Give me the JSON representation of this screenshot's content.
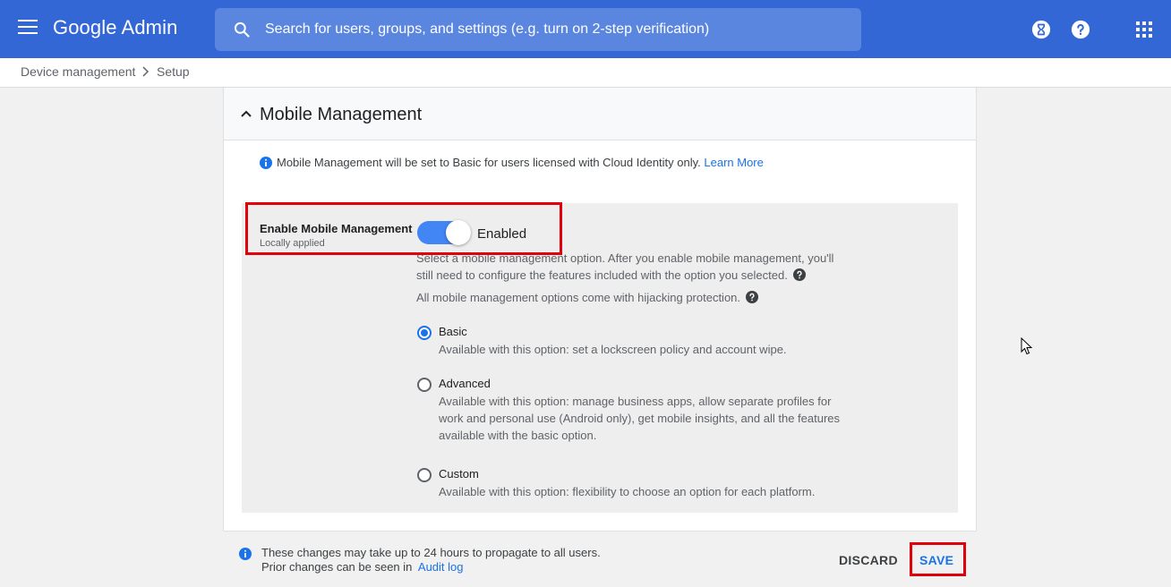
{
  "header": {
    "brand": "Google Admin",
    "search_placeholder": "Search for users, groups, and settings (e.g. turn on 2-step verification)",
    "icons": [
      "menu-icon",
      "search-icon",
      "hourglass-icon",
      "help-icon",
      "apps-grid-icon"
    ]
  },
  "breadcrumb": {
    "items": [
      "Device management",
      "Setup"
    ]
  },
  "card": {
    "title": "Mobile Management",
    "info_text": "Mobile Management will be set to Basic for users licensed with Cloud Identity only.",
    "info_link": "Learn More",
    "setting": {
      "label": "Enable Mobile Management",
      "sublabel": "Locally applied",
      "toggle_state": "Enabled",
      "toggle_on": true,
      "description_1": "Select a mobile management option. After you enable mobile management, you'll still need to configure the features included with the option you selected.",
      "description_2": "All mobile management options come with hijacking protection."
    },
    "options": [
      {
        "title": "Basic",
        "desc": "Available with this option: set a lockscreen policy and account wipe.",
        "selected": true
      },
      {
        "title": "Advanced",
        "desc": "Available with this option: manage business apps, allow separate profiles for work and personal use (Android only), get mobile insights, and all the features available with the basic option.",
        "selected": false
      },
      {
        "title": "Custom",
        "desc": "Available with this option: flexibility to choose an option for each platform.",
        "selected": false
      }
    ]
  },
  "footer": {
    "note_line_1": "These changes may take up to 24 hours to propagate to all users.",
    "note_line_2_prefix": "Prior changes can be seen in",
    "note_link": "Audit log",
    "discard_label": "DISCARD",
    "save_label": "SAVE"
  },
  "colors": {
    "topbar": "#3367d6",
    "accent": "#1a73e8",
    "toggle_on": "#4285f4",
    "highlight": "#e0000b"
  }
}
